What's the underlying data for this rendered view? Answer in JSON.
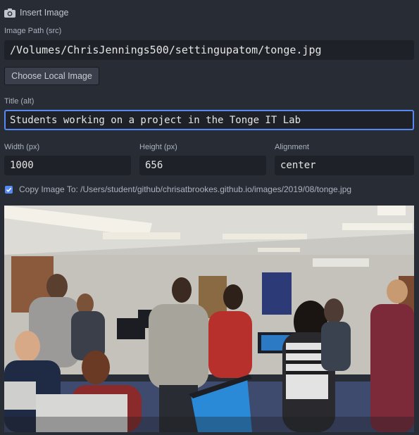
{
  "panel": {
    "title": "Insert Image",
    "icon": "camera-icon"
  },
  "src": {
    "label": "Image Path (src)",
    "value": "/Volumes/ChrisJennings500/settingupatom/tonge.jpg"
  },
  "choose_button": {
    "label": "Choose Local Image"
  },
  "alt": {
    "label": "Title (alt)",
    "value": "Students working on a project in the Tonge IT Lab"
  },
  "width": {
    "label": "Width (px)",
    "value": "1000"
  },
  "height": {
    "label": "Height (px)",
    "value": "656"
  },
  "alignment": {
    "label": "Alignment",
    "value": "center"
  },
  "copy": {
    "checked": true,
    "label": "Copy Image To: /Users/student/github/chrisatbrookes.github.io/images/2019/08/tonge.jpg"
  },
  "colors": {
    "background": "#282c34",
    "field": "#1e2127",
    "accent": "#568af2"
  }
}
